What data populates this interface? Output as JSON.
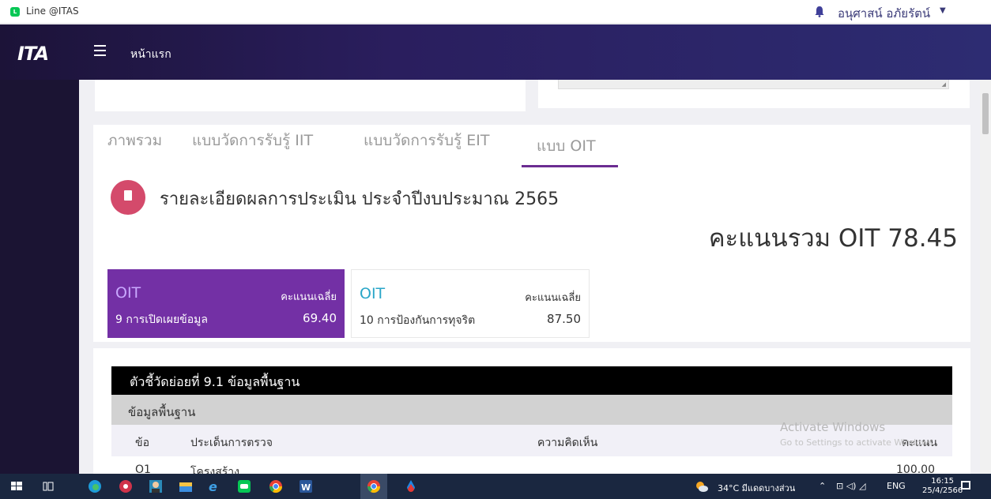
{
  "browser": {
    "tab_label": "Line @ITAS"
  },
  "user": {
    "name": "อนุศาสน์ อภัยรัตน์"
  },
  "navbar": {
    "logo": "ITA",
    "home_label": "หน้าแรก"
  },
  "tabs": [
    {
      "label": "ภาพรวม"
    },
    {
      "label": "แบบวัดการรับรู้ IIT"
    },
    {
      "label": "แบบวัดการรับรู้ EIT"
    },
    {
      "label": "แบบ OIT"
    }
  ],
  "report": {
    "title": "รายละเอียดผลการประเมิน ประจำปีงบประมาณ 2565",
    "total_score": "คะแนนรวม OIT 78.45"
  },
  "oit_cards": [
    {
      "label": "OIT",
      "avg_label": "คะแนนเฉลี่ย",
      "name": "9 การเปิดเผยข้อมูล",
      "value": "69.40"
    },
    {
      "label": "OIT",
      "avg_label": "คะแนนเฉลี่ย",
      "name": "10 การป้องกันการทุจริต",
      "value": "87.50"
    }
  ],
  "detail": {
    "section_title": "ตัวชี้วัดย่อยที่ 9.1 ข้อมูลพื้นฐาน",
    "group_label": "ข้อมูลพื้นฐาน",
    "columns": [
      "ข้อ",
      "ประเด็นการตรวจ",
      "ความคิดเห็น",
      "คะแนน"
    ],
    "rows": [
      {
        "no": "O1",
        "item": "โครงสร้าง",
        "comment": "",
        "score": "100.00"
      }
    ]
  },
  "watermark": {
    "title": "Activate Windows",
    "subtitle": "Go to Settings to activate Windows."
  },
  "taskbar": {
    "weather": "34°C มีแดดบางส่วน",
    "language": "ENG",
    "time": "16:15",
    "date": "25/4/2566"
  },
  "colors": {
    "accent_purple": "#7330a5",
    "tab_underline": "#6b2c91",
    "report_icon": "#d44a6b",
    "oit_cyan": "#2aa6c8"
  }
}
